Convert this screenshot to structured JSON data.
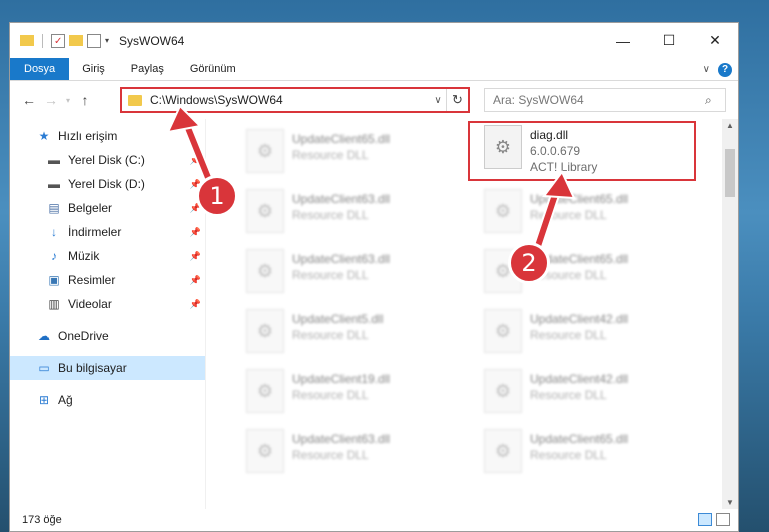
{
  "window": {
    "title": "SysWOW64",
    "controls": {
      "minimize": "—",
      "maximize": "☐",
      "close": "✕"
    }
  },
  "ribbon": {
    "tabs": [
      {
        "label": "Dosya"
      },
      {
        "label": "Giriş"
      },
      {
        "label": "Paylaş"
      },
      {
        "label": "Görünüm"
      }
    ],
    "help": "?"
  },
  "address": {
    "path": "C:\\Windows\\SysWOW64",
    "search_placeholder": "Ara: SysWOW64"
  },
  "nav": {
    "items": [
      {
        "label": "Hızlı erişim",
        "icon": "star-icon",
        "glyph": "★",
        "color": "#2b7cd3",
        "pinned": false,
        "indent": 0
      },
      {
        "label": "Yerel Disk (C:)",
        "icon": "drive-icon",
        "glyph": "▬",
        "color": "#555",
        "pinned": true,
        "indent": 1
      },
      {
        "label": "Yerel Disk (D:)",
        "icon": "drive-icon",
        "glyph": "▬",
        "color": "#555",
        "pinned": true,
        "indent": 1
      },
      {
        "label": "Belgeler",
        "icon": "document-icon",
        "glyph": "▤",
        "color": "#4a6fa5",
        "pinned": true,
        "indent": 1
      },
      {
        "label": "İndirmeler",
        "icon": "download-icon",
        "glyph": "↓",
        "color": "#2b7cd3",
        "pinned": true,
        "indent": 1
      },
      {
        "label": "Müzik",
        "icon": "music-icon",
        "glyph": "♪",
        "color": "#2b7cd3",
        "pinned": true,
        "indent": 1
      },
      {
        "label": "Resimler",
        "icon": "pictures-icon",
        "glyph": "▣",
        "color": "#3a78b5",
        "pinned": true,
        "indent": 1
      },
      {
        "label": "Videolar",
        "icon": "video-icon",
        "glyph": "▥",
        "color": "#444",
        "pinned": true,
        "indent": 1
      },
      {
        "label": "OneDrive",
        "icon": "cloud-icon",
        "glyph": "☁",
        "color": "#1f6fc5",
        "pinned": false,
        "indent": 0
      },
      {
        "label": "Bu bilgisayar",
        "icon": "computer-icon",
        "glyph": "▭",
        "color": "#2b7cd3",
        "pinned": false,
        "indent": 0,
        "selected": true
      },
      {
        "label": "Ağ",
        "icon": "network-icon",
        "glyph": "⊞",
        "color": "#2b7cd3",
        "pinned": false,
        "indent": 0
      }
    ]
  },
  "files": {
    "highlighted": {
      "name": "diag.dll",
      "version": "6.0.0.679",
      "description": "ACT! Library"
    },
    "left_column": [
      {
        "name": "UpdateClient65.dll",
        "description": "Resource DLL"
      },
      {
        "name": "UpdateClient63.dll",
        "description": "Resource DLL"
      },
      {
        "name": "UpdateClient63.dll",
        "description": "Resource DLL"
      },
      {
        "name": "UpdateClient5.dll",
        "description": "Resource DLL"
      },
      {
        "name": "UpdateClient19.dll",
        "description": "Resource DLL"
      },
      {
        "name": "UpdateClient63.dll",
        "description": "Resource DLL"
      }
    ],
    "right_column": [
      {
        "name": "UpdateClient65.dll",
        "description": "Resource DLL"
      },
      {
        "name": "UpdateClient65.dll",
        "description": "Resource DLL"
      },
      {
        "name": "UpdateClient42.dll",
        "description": "Resource DLL"
      },
      {
        "name": "UpdateClient42.dll",
        "description": "Resource DLL"
      },
      {
        "name": "UpdateClient65.dll",
        "description": "Resource DLL"
      }
    ]
  },
  "status": {
    "count": "173 öğe"
  },
  "annotations": {
    "step1": "1",
    "step2": "2",
    "accent": "#d9353a"
  },
  "colors": {
    "file_tab": "#1979ca",
    "selected_nav": "#cce8ff"
  }
}
